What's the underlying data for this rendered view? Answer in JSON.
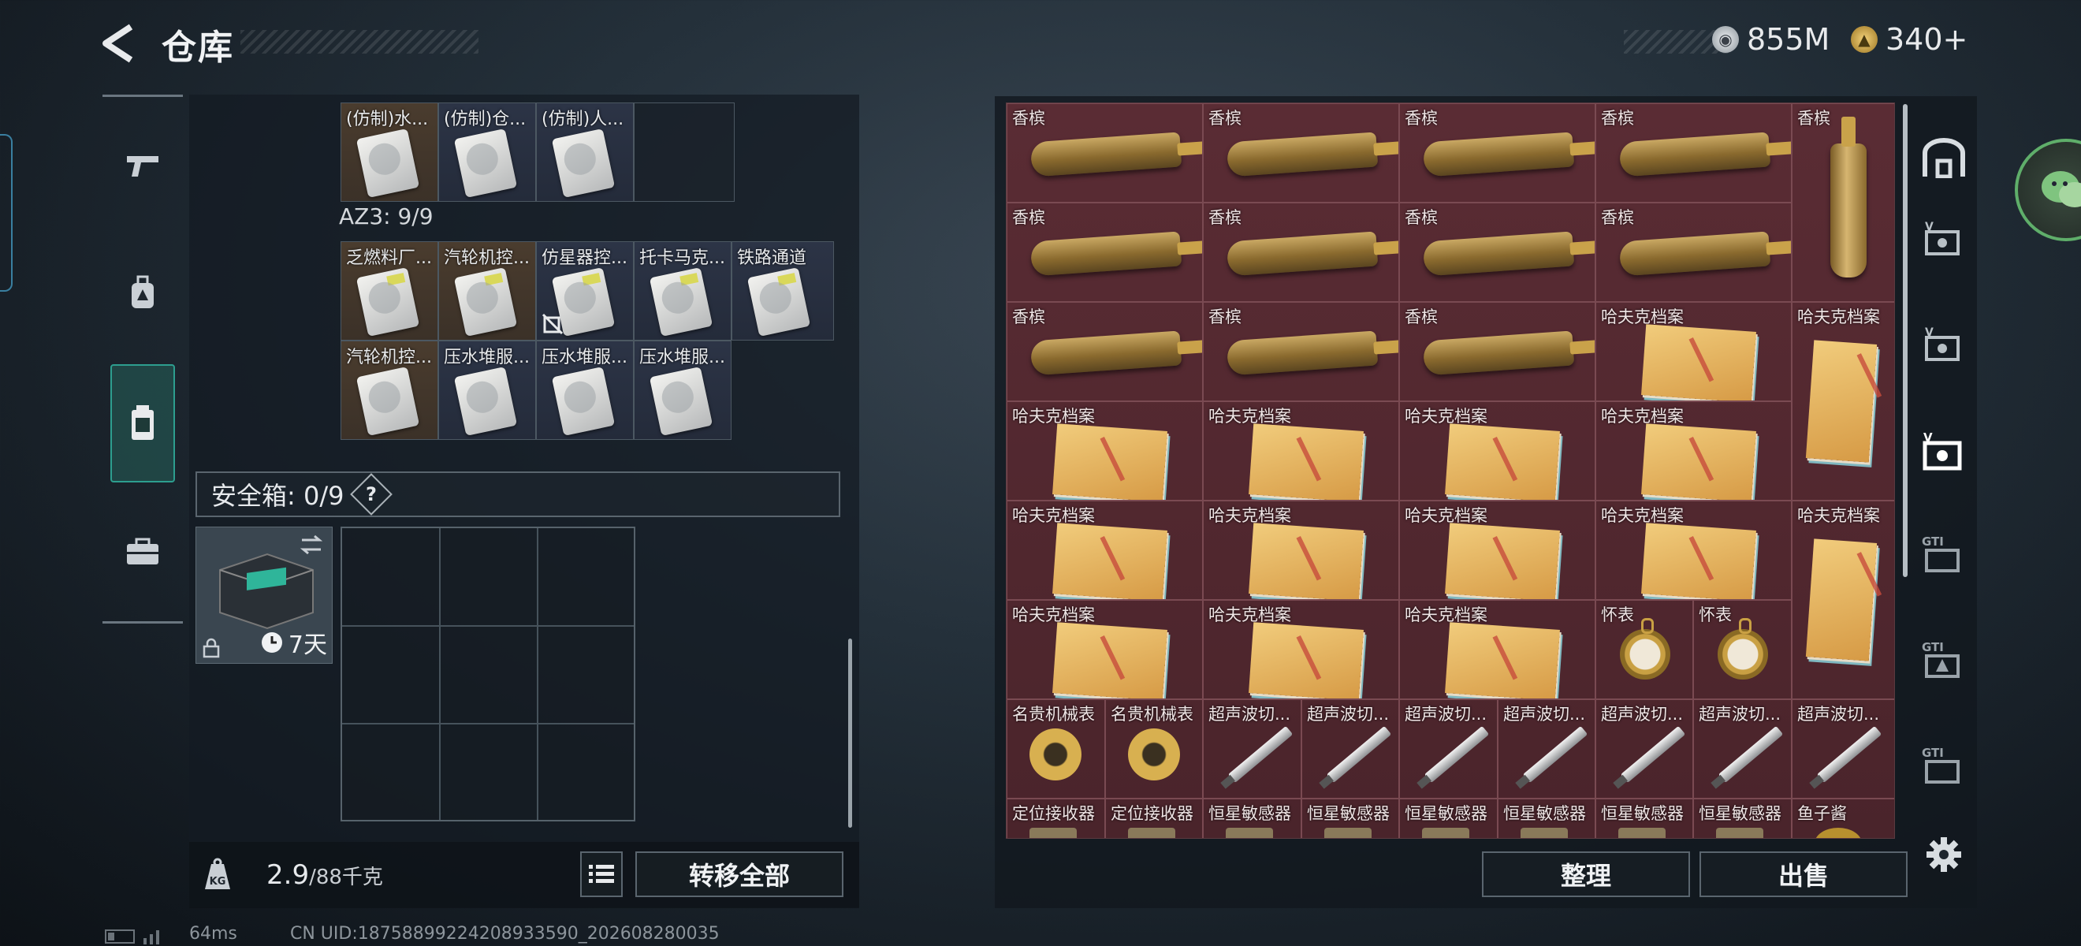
{
  "header": {
    "title": "仓库",
    "currency1": "855M",
    "currency2": "340+"
  },
  "left": {
    "row1": [
      "(仿制)水...",
      "(仿制)仓...",
      "(仿制)人..."
    ],
    "az3_label": "AZ3: 9/9",
    "az3_row1": [
      "乏燃料厂...",
      "汽轮机控...",
      "仿星器控...",
      "托卡马克...",
      "铁路通道"
    ],
    "az3_row2": [
      "汽轮机控...",
      "压水堆服...",
      "压水堆服...",
      "压水堆服..."
    ],
    "safe_label": "安全箱: 0/9",
    "safe_help": "?",
    "safe_days": "7天",
    "weight_value": "2.9",
    "weight_max": "/88千克",
    "transfer_all": "转移全部"
  },
  "right": {
    "items_row1": [
      "香槟",
      "香槟",
      "香槟",
      "香槟",
      "香槟"
    ],
    "items_row2": [
      "香槟",
      "香槟",
      "香槟",
      "香槟"
    ],
    "items_row3": [
      "香槟",
      "香槟",
      "香槟",
      "哈夫克档案",
      "哈夫克档案"
    ],
    "items_row4": [
      "哈夫克档案",
      "哈夫克档案",
      "哈夫克档案",
      "哈夫克档案"
    ],
    "items_row5": [
      "哈夫克档案",
      "哈夫克档案",
      "哈夫克档案",
      "哈夫克档案",
      "哈夫克档案"
    ],
    "items_row6": [
      "哈夫克档案",
      "哈夫克档案",
      "哈夫克档案",
      "怀表",
      "怀表"
    ],
    "items_row7": [
      "名贵机械表",
      "名贵机械表",
      "超声波切...",
      "超声波切...",
      "超声波切...",
      "超声波切...",
      "超声波切...",
      "超声波切...",
      "超声波切..."
    ],
    "items_row8": [
      "定位接收器",
      "定位接收器",
      "恒星敏感器",
      "恒星敏感器",
      "恒星敏感器",
      "恒星敏感器",
      "恒星敏感器",
      "恒星敏感器",
      "鱼子酱"
    ],
    "sort_button": "整理",
    "sell_button": "出售"
  },
  "status": {
    "ping": "64ms",
    "uid": "CN UID:18758899224208933590_202608280035"
  }
}
